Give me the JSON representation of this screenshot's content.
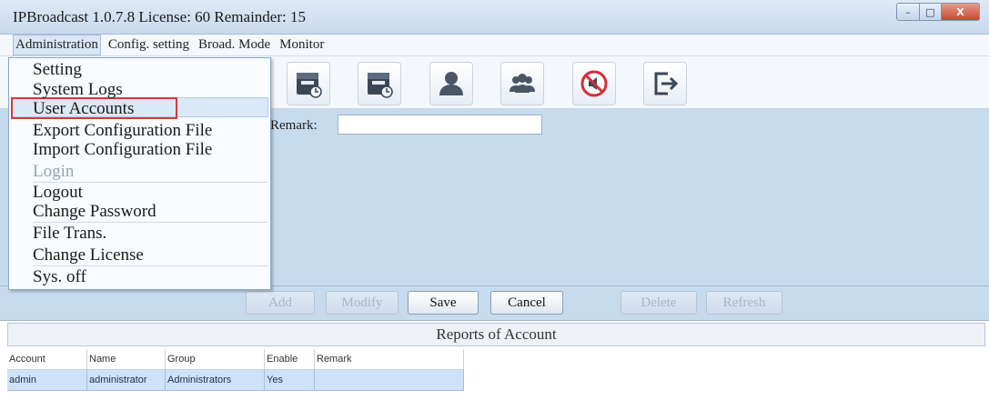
{
  "window": {
    "title": "IPBroadcast 1.0.7.8 License: 60 Remainder: 15",
    "buttons": {
      "minimize": "–",
      "maximize": "□",
      "close": "X"
    }
  },
  "menubar": {
    "items": [
      "Administration",
      "Config. setting",
      "Broad. Mode",
      "Monitor"
    ]
  },
  "toolbar": {
    "icons": [
      "schedule-calendar-icon",
      "schedule-clock-icon",
      "user-icon",
      "group-icon",
      "mute-icon",
      "exit-icon"
    ]
  },
  "dropdown": {
    "items": [
      {
        "label": "Setting",
        "enabled": true
      },
      {
        "label": "System Logs",
        "enabled": true
      },
      {
        "label": "User Accounts",
        "enabled": true,
        "highlighted": true
      },
      {
        "label": "Export Configuration File",
        "enabled": true
      },
      {
        "label": "Import Configuration File",
        "enabled": true
      },
      {
        "label": "Login",
        "enabled": false
      },
      {
        "label": "Logout",
        "enabled": true
      },
      {
        "label": "Change Password",
        "enabled": true
      },
      {
        "label": "File Trans.",
        "enabled": true
      },
      {
        "label": "Change License",
        "enabled": true
      },
      {
        "label": "Sys. off",
        "enabled": true
      }
    ]
  },
  "form": {
    "remark_label": "Remark:",
    "remark_value": ""
  },
  "buttons": {
    "add": "Add",
    "modify": "Modify",
    "save": "Save",
    "cancel": "Cancel",
    "delete": "Delete",
    "refresh": "Refresh"
  },
  "report": {
    "title": "Reports of Account",
    "columns": [
      "Account",
      "Name",
      "Group",
      "Enable",
      "Remark"
    ],
    "rows": [
      [
        "admin",
        "administrator",
        "Administrators",
        "Yes",
        ""
      ]
    ]
  },
  "colors": {
    "panel": "#c7dbee",
    "highlight_box": "#d33b3b",
    "selected_row": "#cde2f7"
  }
}
